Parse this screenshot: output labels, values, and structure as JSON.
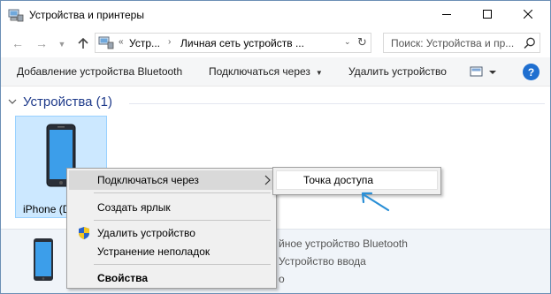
{
  "window": {
    "title": "Устройства и принтеры",
    "icon": "devices-printers-icon"
  },
  "window_controls": {
    "minimize": "minimize-icon",
    "maximize": "maximize-icon",
    "close": "close-icon"
  },
  "address_bar": {
    "crumbs": [
      "Устр...",
      "Личная сеть устройств ..."
    ],
    "search_placeholder": "Поиск: Устройства и пр..."
  },
  "command_bar": {
    "add_bluetooth": "Добавление устройства Bluetooth",
    "connect_via": "Подключаться через",
    "remove_device": "Удалить устройство",
    "help": "?"
  },
  "content": {
    "group_title": "Устройства (1)",
    "device_label": "iPhone (D"
  },
  "details": {
    "line1": "йное устройство Bluetooth",
    "line2": "Устройство ввода",
    "line3": "о"
  },
  "context_menu": {
    "connect_via": "Подключаться через",
    "create_shortcut": "Создать ярлык",
    "remove_device": "Удалить устройство",
    "troubleshoot": "Устранение неполадок",
    "properties": "Свойства"
  },
  "submenu": {
    "access_point": "Точка доступа"
  },
  "colors": {
    "accent_blue": "#1f6fd0",
    "selection_fill": "#cce8ff",
    "selection_border": "#99d1ff",
    "group_title": "#1e3a8a",
    "annotation_arrow": "#2a8fd6"
  }
}
